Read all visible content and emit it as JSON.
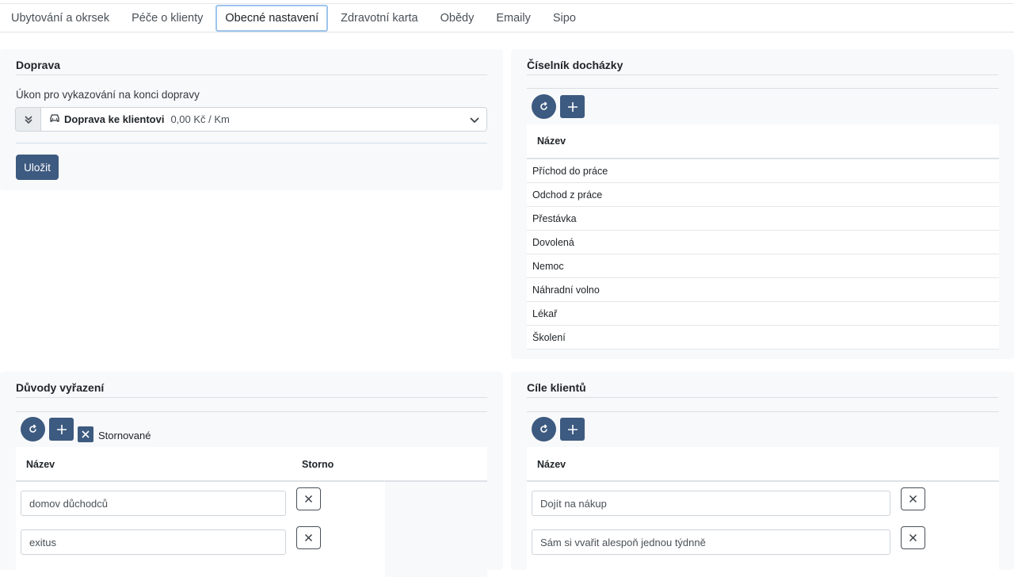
{
  "tabs": [
    {
      "label": "Ubytování a okrsek"
    },
    {
      "label": "Péče o klienty"
    },
    {
      "label": "Obecné nastavení"
    },
    {
      "label": "Zdravotní karta"
    },
    {
      "label": "Obědy"
    },
    {
      "label": "Emaily"
    },
    {
      "label": "Sipo"
    }
  ],
  "doprava": {
    "title": "Doprava",
    "field_label": "Úkon pro vykazování na konci dopravy",
    "selected_name": "Doprava ke klientovi",
    "selected_price": "0,00 Kč / Km",
    "save_label": "Uložit"
  },
  "dochazka": {
    "title": "Číselník docházky",
    "column_name": "Název",
    "rows": [
      "Příchod do práce",
      "Odchod z práce",
      "Přestávka",
      "Dovolená",
      "Nemoc",
      "Náhradní volno",
      "Lékař",
      "Školení"
    ]
  },
  "duvody": {
    "title": "Důvody vyřazení",
    "stornovane_label": "Stornované",
    "column_name": "Název",
    "column_storno": "Storno",
    "rows": [
      "domov důchodců",
      "exitus"
    ]
  },
  "cile": {
    "title": "Cíle klientů",
    "column_name": "Název",
    "rows": [
      "Dojít na nákup",
      "Sám si vvařit alespoň jednou týdnně"
    ]
  },
  "colors": {
    "primary": "#3d5a80",
    "card_bg": "#f8f9fa",
    "active_tab_border": "#9ec5ec"
  }
}
